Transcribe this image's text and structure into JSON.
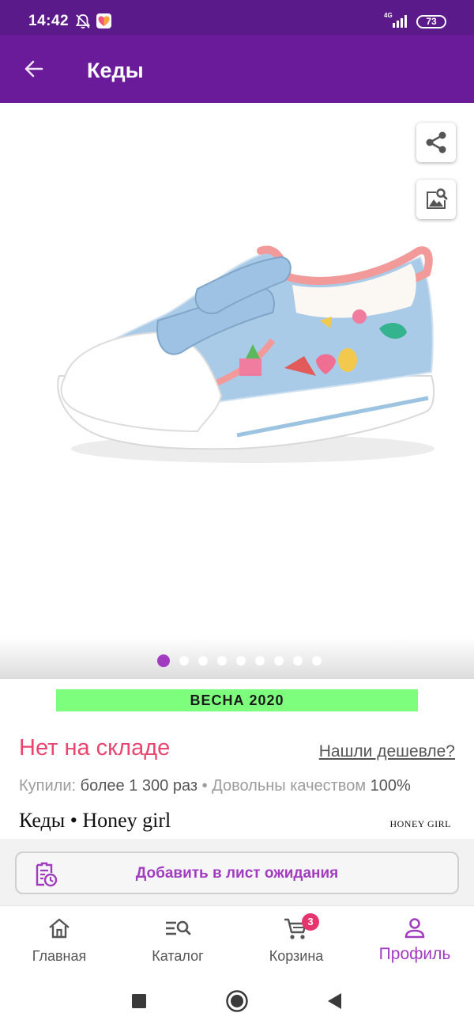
{
  "status_bar": {
    "time": "14:42",
    "network": "4G",
    "battery": "73",
    "icons": [
      "bell-off-icon",
      "app-heart-icon",
      "signal-icon",
      "battery-icon"
    ]
  },
  "app_bar": {
    "title": "Кеды",
    "back_icon": "arrow-left-icon",
    "background": "#6a1b9a"
  },
  "gallery": {
    "image": "sneaker-photo",
    "slide_count": 9,
    "active_slide": 1,
    "actions": [
      "share-icon",
      "image-search-icon"
    ]
  },
  "banner": {
    "text": "ВЕСНА 2020",
    "color": "#7dfe7d"
  },
  "product": {
    "stock_status": "Нет на складе",
    "cheaper_link": "Нашли дешевле?",
    "bought_label": "Купили:",
    "bought_value": "более 1 300 раз",
    "separator": "•",
    "quality_label": "Довольны качеством",
    "quality_value": "100%",
    "name": "Кеды • Honey girl",
    "brand_logo": "HONEY GIRL"
  },
  "wait_list": {
    "label": "Добавить в лист ожидания",
    "icon": "clipboard-clock-icon"
  },
  "bottom_nav": {
    "items": [
      {
        "label": "Главная",
        "icon": "home-icon"
      },
      {
        "label": "Каталог",
        "icon": "catalog-search-icon"
      },
      {
        "label": "Корзина",
        "icon": "cart-icon"
      },
      {
        "label": "Профиль",
        "icon": "profile-icon"
      }
    ],
    "cart_badge": "3",
    "active": "Профиль"
  },
  "system_nav": {
    "icons": [
      "recents-square-icon",
      "home-circle-icon",
      "back-triangle-icon"
    ]
  },
  "colors": {
    "accent": "#a13bbf",
    "alert": "#e8456f",
    "status_bar": "#5b1a8a"
  }
}
